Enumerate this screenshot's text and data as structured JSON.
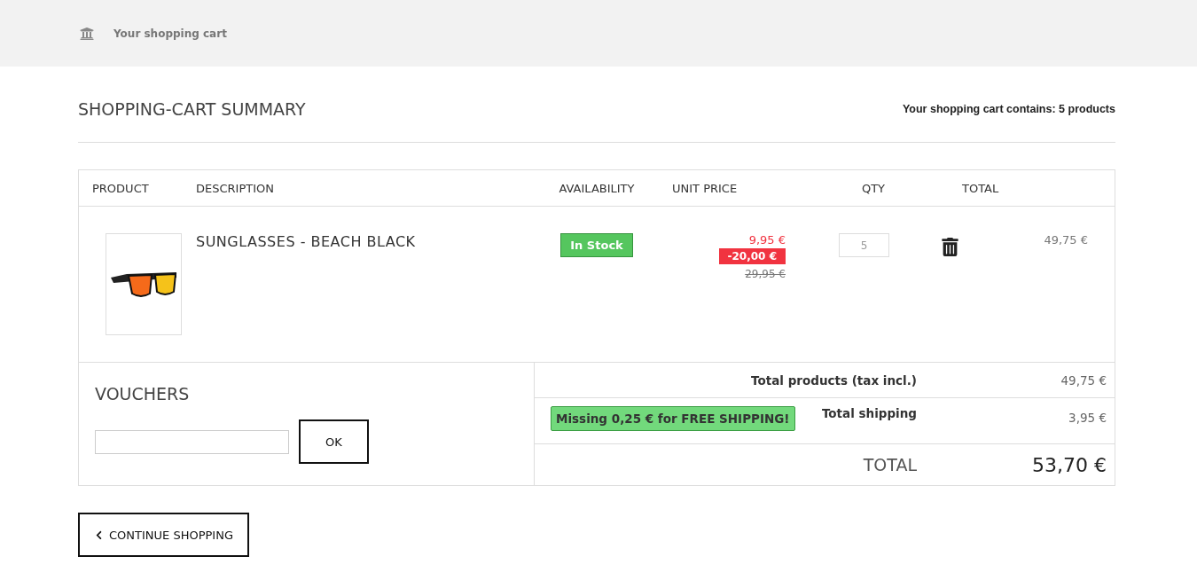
{
  "breadcrumb": {
    "label": "Your shopping cart"
  },
  "heading": {
    "title": "SHOPPING-CART SUMMARY",
    "summary": "Your shopping cart contains: 5 products"
  },
  "table": {
    "columns": [
      "PRODUCT",
      "DESCRIPTION",
      "AVAILABILITY",
      "UNIT PRICE",
      "QTY",
      "TOTAL"
    ],
    "rows": [
      {
        "name": "SUNGLASSES - BEACH BLACK",
        "availability": "In Stock",
        "in_stock": true,
        "price": "9,95 €",
        "discount": "-20,00 €",
        "old_price": "29,95 €",
        "qty": "5",
        "total": "49,75 €"
      }
    ]
  },
  "vouchers": {
    "title": "VOUCHERS",
    "button": "OK"
  },
  "totals": {
    "shipping_notice": "Missing 0,25 € for FREE SHIPPING!",
    "rows": [
      {
        "kind": "normal",
        "label": "Total products (tax incl.)",
        "value": "49,75 €"
      },
      {
        "kind": "shipping",
        "label": "Total shipping",
        "value": "3,95 €"
      },
      {
        "kind": "grand",
        "label": "TOTAL",
        "value": "53,70 €"
      }
    ]
  },
  "continue_button": "CONTINUE SHOPPING"
}
